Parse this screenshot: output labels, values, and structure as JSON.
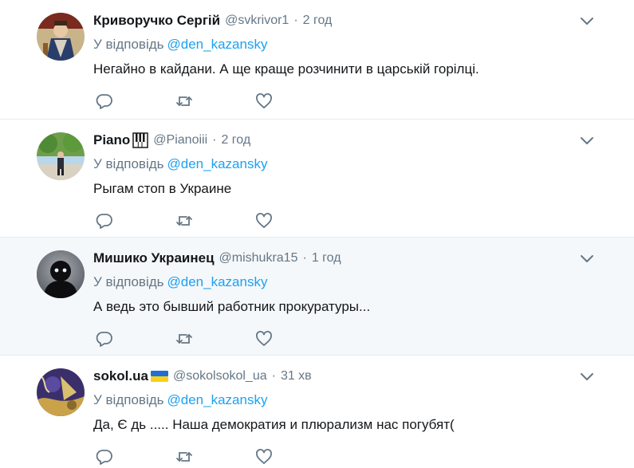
{
  "reply_prefix": "У відповідь",
  "colors": {
    "accent": "#1da1f2",
    "muted": "#657786",
    "text": "#14171a",
    "highlight_bg": "#f5f8fa"
  },
  "tweets": [
    {
      "name": "Криворучко Сергій",
      "handle": "@svkrivor1",
      "separator": "·",
      "time": "2 год",
      "mention": "@den_kazansky",
      "text": "Негайно в кайдани. А ще краще розчинити в царській горілці.",
      "badge_icon": "",
      "avatar_icon": "painted-portrait-avatar"
    },
    {
      "name": "Piano",
      "handle": "@Pianoiii",
      "separator": "·",
      "time": "2 год",
      "mention": "@den_kazansky",
      "text": "Рыгам стоп в Украине",
      "badge_icon": "piano-keys-emoji",
      "avatar_icon": "outdoor-photo-avatar"
    },
    {
      "name": "Мишико Украинец",
      "handle": "@mishukra15",
      "separator": "·",
      "time": "1 год",
      "mention": "@den_kazansky",
      "text": "А ведь это бывший работник прокуратуры...",
      "badge_icon": "",
      "avatar_icon": "dark-figure-avatar"
    },
    {
      "name": "sokol.ua",
      "handle": "@sokolsokol_ua",
      "separator": "·",
      "time": "31 хв",
      "mention": "@den_kazansky",
      "text": "Да, Є   дь ..... Наша демократия и плюрализм нас погубят(",
      "badge_icon": "ukraine-flag-emoji",
      "avatar_icon": "abstract-art-avatar"
    }
  ]
}
